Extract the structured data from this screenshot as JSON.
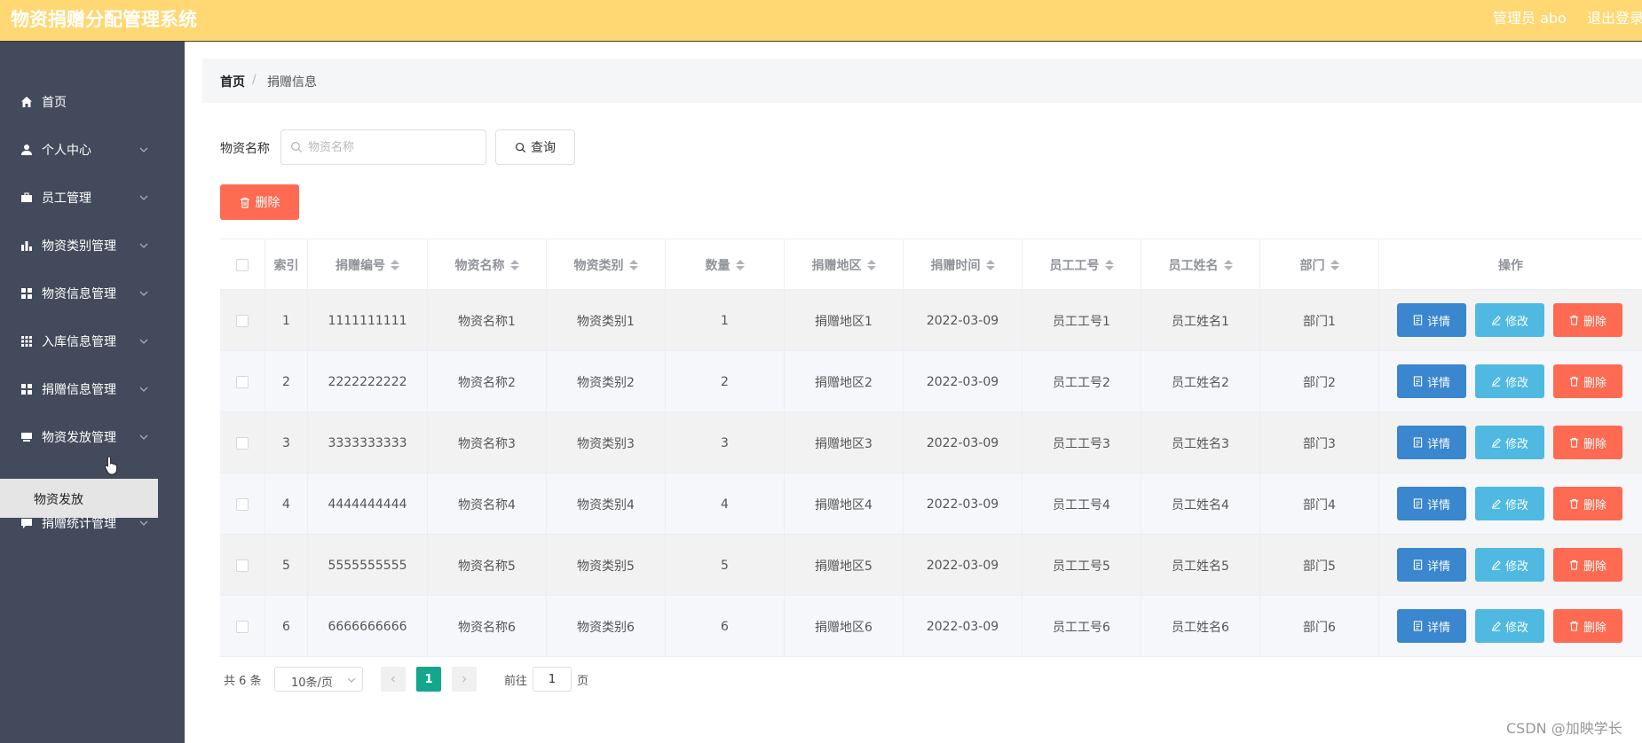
{
  "header": {
    "title": "物资捐赠分配管理系统",
    "admin": "管理员 abo",
    "logout": "退出登录"
  },
  "sidebar": {
    "items": [
      {
        "label": "首页",
        "icon": "home-icon"
      },
      {
        "label": "个人中心",
        "icon": "user-icon"
      },
      {
        "label": "员工管理",
        "icon": "briefcase-icon"
      },
      {
        "label": "物资类别管理",
        "icon": "bar-chart-icon"
      },
      {
        "label": "物资信息管理",
        "icon": "grid-icon"
      },
      {
        "label": "入库信息管理",
        "icon": "apps-icon"
      },
      {
        "label": "捐赠信息管理",
        "icon": "grid-icon"
      },
      {
        "label": "物资发放管理",
        "icon": "drive-icon"
      },
      {
        "label": "捐赠统计管理",
        "icon": "message-icon"
      }
    ],
    "submenu_active": "物资发放"
  },
  "breadcrumb": {
    "home": "首页",
    "separator": "/",
    "current": "捐赠信息"
  },
  "search": {
    "label": "物资名称",
    "placeholder": "物资名称",
    "query_button": "查询"
  },
  "toolbar": {
    "delete_label": "删除"
  },
  "table": {
    "headers": [
      "索引",
      "捐赠编号",
      "物资名称",
      "物资类别",
      "数量",
      "捐赠地区",
      "捐赠时间",
      "员工工号",
      "员工姓名",
      "部门",
      "操作"
    ],
    "rows": [
      {
        "index": "1",
        "no": "1111111111",
        "name": "物资名称1",
        "category": "物资类别1",
        "qty": "1",
        "region": "捐赠地区1",
        "time": "2022-03-09",
        "emp_no": "员工工号1",
        "emp_name": "员工姓名1",
        "dept": "部门1"
      },
      {
        "index": "2",
        "no": "2222222222",
        "name": "物资名称2",
        "category": "物资类别2",
        "qty": "2",
        "region": "捐赠地区2",
        "time": "2022-03-09",
        "emp_no": "员工工号2",
        "emp_name": "员工姓名2",
        "dept": "部门2"
      },
      {
        "index": "3",
        "no": "3333333333",
        "name": "物资名称3",
        "category": "物资类别3",
        "qty": "3",
        "region": "捐赠地区3",
        "time": "2022-03-09",
        "emp_no": "员工工号3",
        "emp_name": "员工姓名3",
        "dept": "部门3"
      },
      {
        "index": "4",
        "no": "4444444444",
        "name": "物资名称4",
        "category": "物资类别4",
        "qty": "4",
        "region": "捐赠地区4",
        "time": "2022-03-09",
        "emp_no": "员工工号4",
        "emp_name": "员工姓名4",
        "dept": "部门4"
      },
      {
        "index": "5",
        "no": "5555555555",
        "name": "物资名称5",
        "category": "物资类别5",
        "qty": "5",
        "region": "捐赠地区5",
        "time": "2022-03-09",
        "emp_no": "员工工号5",
        "emp_name": "员工姓名5",
        "dept": "部门5"
      },
      {
        "index": "6",
        "no": "6666666666",
        "name": "物资名称6",
        "category": "物资类别6",
        "qty": "6",
        "region": "捐赠地区6",
        "time": "2022-03-09",
        "emp_no": "员工工号6",
        "emp_name": "员工姓名6",
        "dept": "部门6"
      }
    ],
    "actions": {
      "detail": "详情",
      "edit": "修改",
      "delete": "删除"
    }
  },
  "pagination": {
    "total": "共 6 条",
    "page_size": "10条/页",
    "current_page": "1",
    "goto_label": "前往",
    "goto_value": "1",
    "page_unit": "页"
  },
  "watermark": "CSDN @加映学长",
  "colors": {
    "header_bg": "#FFD873",
    "sidebar_bg": "#424A5B",
    "detail_btn": "#3A86CF",
    "edit_btn": "#4FB9E1",
    "delete_btn": "#FE6A52",
    "active_page": "#15A68E"
  }
}
